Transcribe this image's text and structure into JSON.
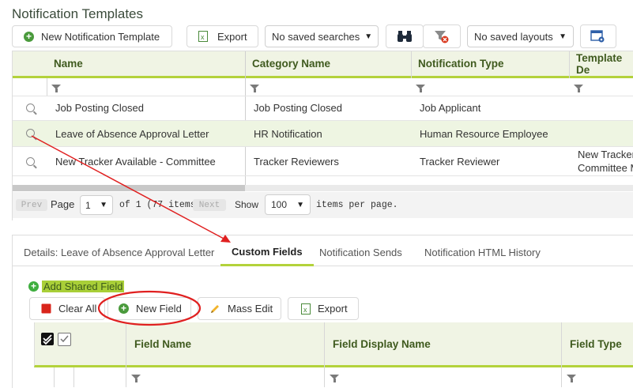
{
  "page": {
    "title": "Notification Templates"
  },
  "toolbar": {
    "new_label": "New Notification Template",
    "export_label": "Export",
    "saved_searches": "No saved searches",
    "saved_layouts": "No saved layouts"
  },
  "grid": {
    "columns": [
      "Name",
      "Category Name",
      "Notification Type",
      "Template De"
    ],
    "rows": [
      {
        "name": "Job Posting Closed",
        "category": "Job Posting Closed",
        "type": "Job Applicant",
        "template": ""
      },
      {
        "name": "Leave of Absence Approval Letter",
        "category": "HR Notification",
        "type": "Human Resource Employee",
        "template": ""
      },
      {
        "name": "New Tracker Available - Committee",
        "category": "Tracker Reviewers",
        "type": "Tracker Reviewer",
        "template_line1": "New Tracker",
        "template_line2": "Committee M"
      }
    ]
  },
  "pager": {
    "prev": "Prev",
    "page_label": "Page",
    "page_value": "1",
    "of_label": "of 1 (77 items)",
    "next": "Next",
    "show_label": "Show",
    "per_page_value": "100",
    "per_page_label": "items per page."
  },
  "tabs": {
    "details": "Details: Leave of Absence Approval Letter",
    "custom_fields": "Custom Fields",
    "sends": "Notification Sends",
    "history": "Notification HTML History"
  },
  "custom": {
    "add_shared": "Add Shared Field",
    "clear_all": "Clear All",
    "new_field": "New Field",
    "mass_edit": "Mass Edit",
    "export": "Export",
    "columns": [
      "Field Name",
      "Field Display Name",
      "Field Type"
    ]
  },
  "colors": {
    "accent": "#b3d23b",
    "header_bg": "#f0f4e4",
    "annotation": "#e02020",
    "selected_row": "#eef5e2"
  }
}
